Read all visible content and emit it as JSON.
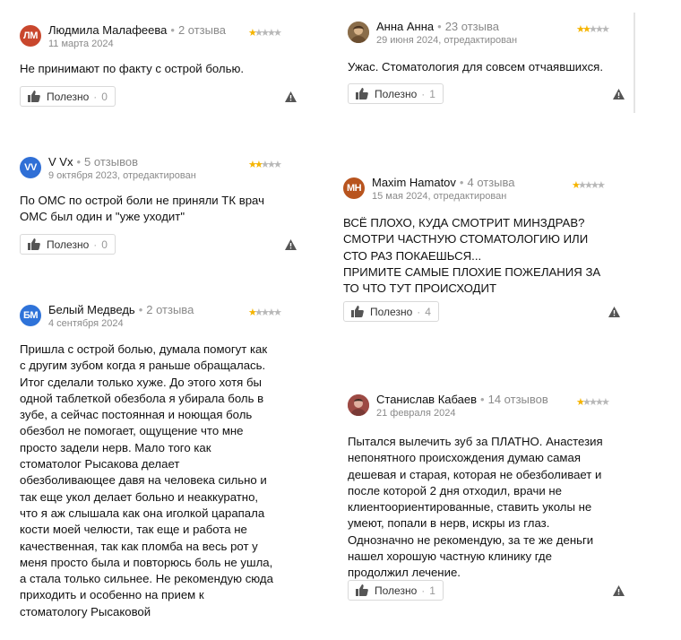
{
  "reviews": [
    {
      "author": "Людмила Малафеева",
      "avatar_text": "ЛМ",
      "avatar_color": "#c9472d",
      "reviews_count": "2 отзыва",
      "date": "11 марта 2024",
      "rating": 1,
      "text": "Не принимают по факту с острой болью.",
      "helpful_label": "Полезно",
      "helpful_count": "0"
    },
    {
      "author": "Анна Анна",
      "avatar_text": "",
      "avatar_color": "#a68660",
      "reviews_count": "23 отзыва",
      "date": "29 июня 2024, отредактирован",
      "rating": 2,
      "text": "Ужас. Стоматология для совсем отчаявшихся.",
      "helpful_label": "Полезно",
      "helpful_count": "1"
    },
    {
      "author": "V Vx",
      "avatar_text": "VV",
      "avatar_color": "#2f6fd6",
      "reviews_count": "5 отзывов",
      "date": "9 октября 2023, отредактирован",
      "rating": 2,
      "text": "По ОМС по острой боли не приняли ТК врач\nОМС был один и \"уже уходит\"",
      "helpful_label": "Полезно",
      "helpful_count": "0"
    },
    {
      "author": "Maxim Hamatov",
      "avatar_text": "MH",
      "avatar_color": "#b8541e",
      "reviews_count": "4 отзыва",
      "date": "15 мая 2024, отредактирован",
      "rating": 1,
      "text": "ВСЁ ПЛОХО, КУДА СМОТРИТ МИНЗДРАВ?\nСМОТРИ ЧАСТНУЮ СТОМАТОЛОГИЮ ИЛИ\nСТО РАЗ ПОКАЕШЬСЯ...\nПРИМИТЕ САМЫЕ ПЛОХИЕ ПОЖЕЛАНИЯ ЗА\nТО ЧТО ТУТ ПРОИСХОДИТ",
      "helpful_label": "Полезно",
      "helpful_count": "4"
    },
    {
      "author": "Белый Медведь",
      "avatar_text": "БМ",
      "avatar_color": "#2f73d9",
      "reviews_count": "2 отзыва",
      "date": "4 сентября 2024",
      "rating": 1,
      "text": "Пришла с острой болью, думала помогут как\nс другим зубом когда я раньше обращалась.\nИтог сделали только хуже. До этого хотя бы\nодной таблеткой обезбола я убирала боль в\nзубе, а сейчас постоянная и ноющая боль\nобезбол не помогает, ощущение что мне\nпросто задели нерв. Мало того как\nстоматолог Рысакова делает\nобезболивающее давя на человека сильно и\nтак еще укол делает больно и неаккуратно,\nчто я аж слышала как она иголкой царапала\nкости моей челюсти, так еще и работа не\nкачественная, так как пломба на весь рот у\nменя просто была и повторюсь боль не ушла,\nа стала только сильнее. Не рекомендую сюда\nприходить и особенно на прием к\nстоматологу Рысаковой"
    },
    {
      "author": "Станислав Кабаев",
      "avatar_text": "",
      "avatar_color": "#b85a52",
      "reviews_count": "14 отзывов",
      "date": "21 февраля 2024",
      "rating": 1,
      "text": "Пытался вылечить зуб за ПЛАТНО. Анастезия\nнепонятного происхождения думаю самая\nдешевая и старая, которая не обезболивает и\nпосле которой 2 дня отходил, врачи не\nклиентоориентированные, ставить уколы не\nумеют, попали в нерв, искры из глаз.\nОднозначно не рекомендую, за те же деньги\nнашел хорошую частную клинику где\nпродолжил лечение.",
      "helpful_label": "Полезно",
      "helpful_count": "1"
    }
  ],
  "colors": {
    "star_on": "#f5b400",
    "star_off": "#b8b8b8"
  },
  "icons": {
    "helpful": "thumb-up-icon",
    "report": "warning-triangle-icon"
  }
}
